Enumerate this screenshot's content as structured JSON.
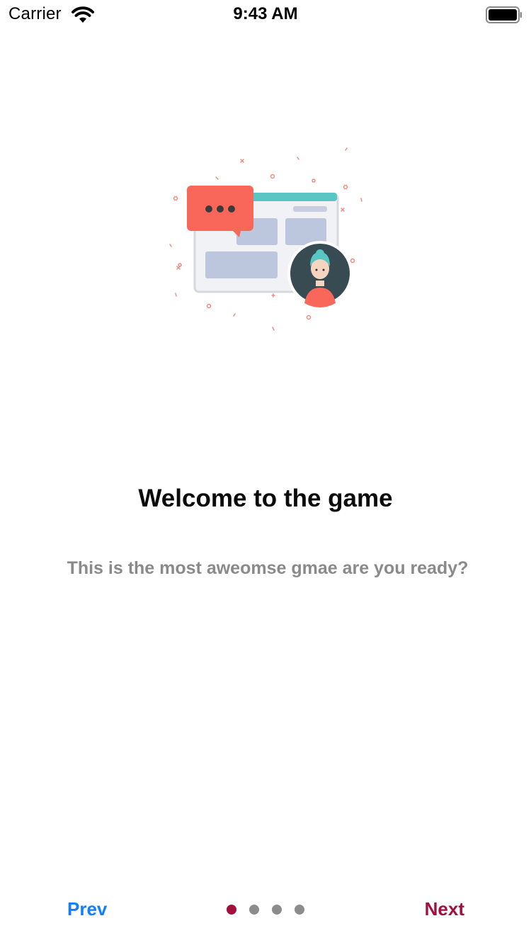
{
  "status_bar": {
    "carrier": "Carrier",
    "time": "9:43 AM"
  },
  "onboarding": {
    "illustration": "chat-window-avatar-illustration",
    "title": "Welcome to the game",
    "subtitle": "This is the most aweomse gmae are you ready?"
  },
  "navigation": {
    "prev_label": "Prev",
    "next_label": "Next",
    "page_count": 4,
    "current_page": 1
  },
  "colors": {
    "prev": "#157efb",
    "next": "#a3103c",
    "active_dot": "#a3103c",
    "inactive_dot": "#8c8c8c",
    "speech_bubble": "#f9675a",
    "window_bar": "#59c6c6",
    "avatar_bg": "#394b52"
  }
}
